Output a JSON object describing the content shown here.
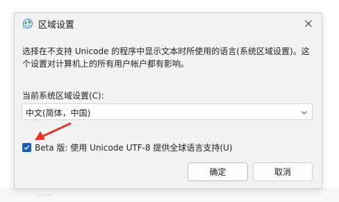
{
  "dialog": {
    "title": "区域设置",
    "close_icon": "close-icon",
    "description": "选择在不支持 Unicode 的程序中显示文本时所使用的语言(系统区域设置)。这个设置对计算机上的所有用户帐户都有影响。",
    "locale_label": "当前系统区域设置(C):",
    "locale_value": "中文(简体，中国)",
    "beta_checkbox": {
      "label": "Beta 版: 使用 Unicode UTF-8 提供全球语言支持(U)",
      "checked": true
    },
    "ok_label": "确定",
    "cancel_label": "取消"
  },
  "background": {
    "partial_text": "……"
  },
  "colors": {
    "accent": "#1a5fb4",
    "annotation_arrow": "#e8322a"
  }
}
